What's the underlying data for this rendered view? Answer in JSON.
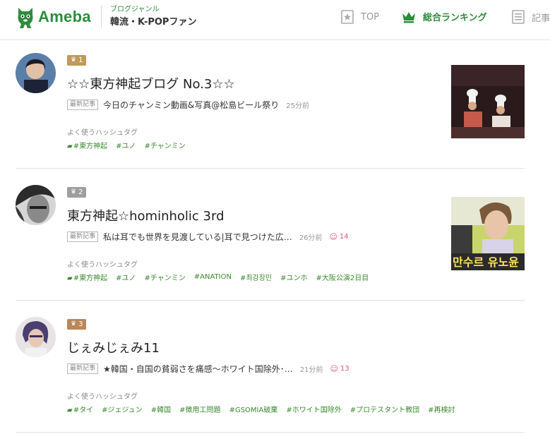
{
  "header": {
    "logo_text": "Ameba",
    "genre_sub": "ブログジャンル",
    "genre_main": "韓流・K-POPファン",
    "nav": [
      {
        "label": "TOP",
        "icon": "star-icon"
      },
      {
        "label": "総合ランキング",
        "icon": "crown-icon"
      },
      {
        "label": "記事",
        "icon": "article-icon"
      }
    ]
  },
  "common": {
    "latest_label": "最新記事",
    "tags_label": "よく使うハッシュタグ"
  },
  "entries": [
    {
      "rank": "1",
      "rank_color": "#c09a5b",
      "title": "☆☆東方神起ブログ No.3☆☆",
      "latest_title": "今日のチャンミン動画&写真@松島ビール祭り",
      "time": "25分前",
      "likes": "",
      "tags": [
        "#東方神起",
        "#ユノ",
        "#チャンミン"
      ]
    },
    {
      "rank": "2",
      "rank_color": "#9e9e9e",
      "title": "東方神起☆hominholic 3rd",
      "latest_title": "私は耳でも世界を見渡している|耳で見つけた広…",
      "time": "26分前",
      "likes": "14",
      "tags": [
        "#東方神起",
        "#ユノ",
        "#チャンミン",
        "#ANATION",
        "#최강창민",
        "#ユンホ",
        "#大阪公演2日目"
      ]
    },
    {
      "rank": "3",
      "rank_color": "#b9875a",
      "title": "じぇみじぇみ11",
      "latest_title": "★韓国・自国の貧弱さを痛感～ホワイト国除外･…",
      "time": "21分前",
      "likes": "13",
      "tags": [
        "#タイ",
        "#ジェジュン",
        "#韓国",
        "#徴用工問題",
        "#GSOMIA破棄",
        "#ホワイト国除外",
        "#プロテスタント教団",
        "#再検討"
      ]
    }
  ],
  "thumb2_text": "만수르 유노윤"
}
